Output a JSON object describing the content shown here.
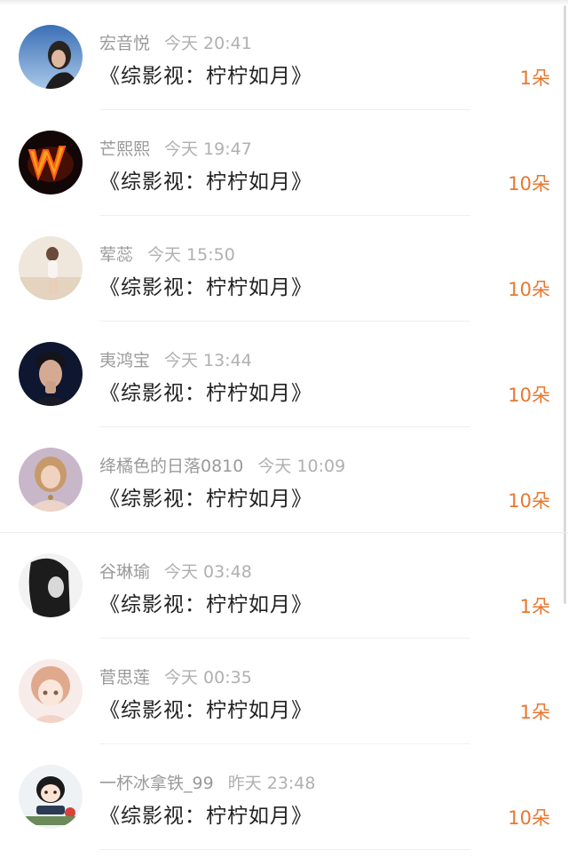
{
  "colors": {
    "count_accent": "#e8772f",
    "title_text": "#222222",
    "meta_text": "#9a9a9a"
  },
  "items": [
    {
      "username": "宏音悦",
      "time": "今天 20:41",
      "title": "《综影视：柠柠如月》",
      "count": "1朵",
      "avatar": "woman-outdoor-avatar"
    },
    {
      "username": "芒熙熙",
      "time": "今天 19:47",
      "title": "《综影视：柠柠如月》",
      "count": "10朵",
      "avatar": "fire-letter-w-avatar"
    },
    {
      "username": "荤蕊",
      "time": "今天 15:50",
      "title": "《综影视：柠柠如月》",
      "count": "10朵",
      "avatar": "girl-beach-avatar"
    },
    {
      "username": "夷鸿宝",
      "time": "今天 13:44",
      "title": "《综影视：柠柠如月》",
      "count": "10朵",
      "avatar": "man-portrait-avatar"
    },
    {
      "username": "绛橘色的日落0810",
      "time": "今天 10:09",
      "title": "《综影视：柠柠如月》",
      "count": "10朵",
      "avatar": "painted-lady-avatar"
    },
    {
      "username": "谷琳瑜",
      "time": "今天 03:48",
      "title": "《综影视：柠柠如月》",
      "count": "1朵",
      "avatar": "bw-woman-avatar"
    },
    {
      "username": "菅思莲",
      "time": "今天 00:35",
      "title": "《综影视：柠柠如月》",
      "count": "1朵",
      "avatar": "anime-girl-avatar"
    },
    {
      "username": "一杯冰拿铁_99",
      "time": "昨天 23:48",
      "title": "《综影视：柠柠如月》",
      "count": "10朵",
      "avatar": "cartoon-pingpong-avatar"
    }
  ]
}
